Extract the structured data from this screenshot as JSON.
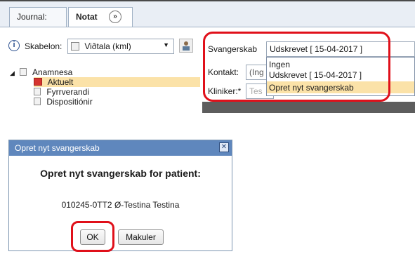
{
  "tabs": {
    "journal": "Journal:",
    "notat": "Notat",
    "notat_icon": "double-chevron-right-icon"
  },
  "template": {
    "label": "Skabelon:",
    "value": "Viðtala (kml)"
  },
  "tree": {
    "root": "Anamnesa",
    "items": [
      "Aktuelt",
      "Fyrrverandi",
      "Dispositiónir"
    ]
  },
  "form": {
    "pregnancy_label": "Svangerskab",
    "pregnancy_value": "Udskrevet [ 15-04-2017 ]",
    "contact_label": "Kontakt:",
    "contact_value": "(Ing",
    "clinician_label": "Kliniker:*",
    "clinician_value": "Tes"
  },
  "dropdown": {
    "options": [
      "Ingen",
      "Udskrevet [ 15-04-2017 ]",
      "Opret nyt svangerskab"
    ],
    "selected_index": 2
  },
  "dialog": {
    "title": "Opret nyt svangerskab",
    "heading": "Opret nyt svangerskab for patient:",
    "patient": "010245-0TT2 Ø-Testina Testina",
    "ok_label": "OK",
    "cancel_label": "Makuler"
  },
  "colors": {
    "highlight_ring": "#e0101a",
    "selection": "#fbe2a8",
    "dialog_title": "#5f87bd"
  }
}
